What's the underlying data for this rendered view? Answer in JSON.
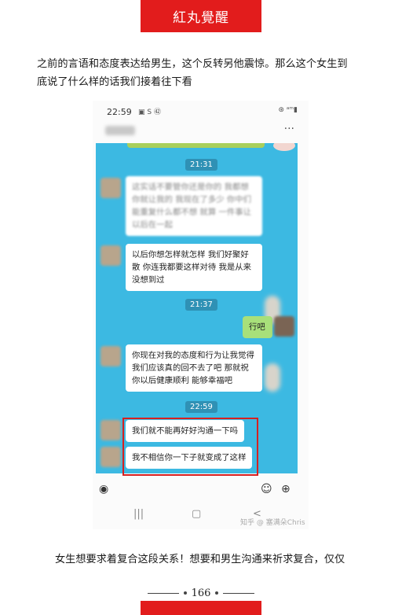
{
  "header": {
    "title": "紅丸覺醒"
  },
  "intro": {
    "line1": "之前的言语和态度表达给男生，这个反转另他震惊。那么这个女生到",
    "line2": "底说了什么样的话我们接着往下看"
  },
  "phone": {
    "status_time": "22:59",
    "status_icons_left": "▣ S ㊷",
    "status_icons_right": "⊛ ᵃᵐ▮",
    "menu_icon": "···",
    "timestamps": [
      "21:31",
      "21:37",
      "22:59"
    ],
    "messages": [
      {
        "side": "left",
        "text": "这实话不要管你还是你的 我都想你就让我的 我现在了多少 你中们能重复什么都不想 就算 一件事让以后在一起",
        "blurred": true
      },
      {
        "side": "left",
        "text": "以后你想怎样就怎样 我们好聚好散 你连我都要这样对待 我是从来没想到过",
        "blurred": false
      },
      {
        "side": "right",
        "text": "行吧",
        "blurred": false
      },
      {
        "side": "left",
        "text": "你现在对我的态度和行为让我觉得我们应该真的回不去了吧 那就祝你以后健康顺利 能够幸福吧",
        "blurred": false
      },
      {
        "side": "left",
        "text": "我们就不能再好好沟通一下吗",
        "blurred": false
      },
      {
        "side": "left",
        "text": "我不相信你一下子就变成了这样",
        "blurred": false
      }
    ],
    "toolbar_left_icon": "voice-icon",
    "toolbar_right_icons": [
      "emoji-icon",
      "plus-icon"
    ],
    "nav": {
      "menu": "|||",
      "home": "▢",
      "back": "<"
    },
    "watermark": "知乎 @ 塞满朵Chris"
  },
  "caption": "女生想要求着复合这段关系！想要和男生沟通来祈求复合，仅仅",
  "page_number": "166",
  "colors": {
    "accent": "#e21c1c",
    "chat_bg": "#3cb9e2",
    "car": "#e02a22"
  }
}
